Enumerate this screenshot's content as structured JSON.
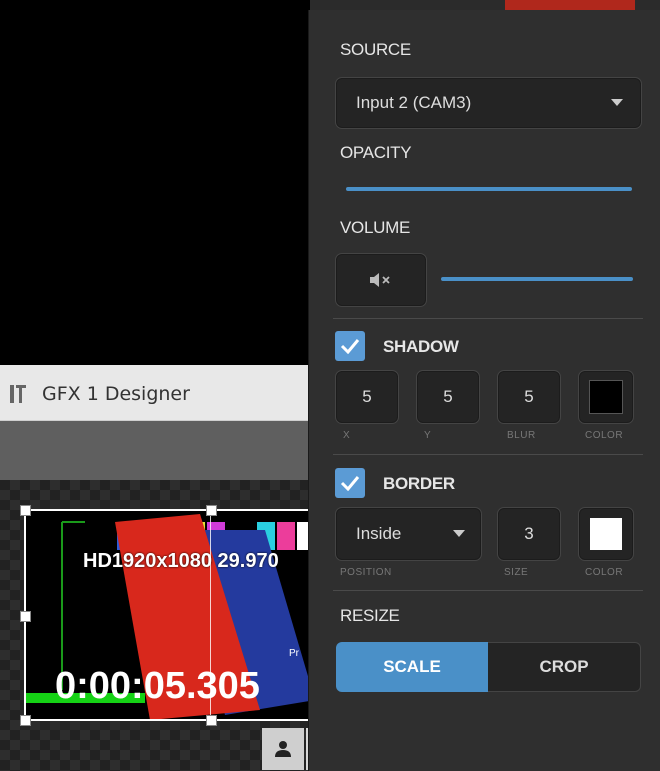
{
  "gfx": {
    "title": "GFX 1 Designer"
  },
  "preview": {
    "format_text": "HD1920x1080 29.970",
    "timecode": "0:00:05.305",
    "corner_text": "Pr"
  },
  "panel": {
    "source": {
      "label": "SOURCE",
      "value": "Input 2 (CAM3)"
    },
    "opacity": {
      "label": "OPACITY",
      "level": 1.0
    },
    "volume": {
      "label": "VOLUME",
      "level": 1.0,
      "mute_icon": "speaker-mute-icon"
    },
    "shadow": {
      "label": "SHADOW",
      "checked": true,
      "x": "5",
      "y": "5",
      "blur": "5",
      "x_label": "X",
      "y_label": "Y",
      "blur_label": "BLUR",
      "color_label": "COLOR",
      "color": "#000000"
    },
    "border": {
      "label": "BORDER",
      "checked": true,
      "position": "Inside",
      "size": "3",
      "position_label": "POSITION",
      "size_label": "SIZE",
      "color_label": "COLOR",
      "color": "#ffffff"
    },
    "resize": {
      "label": "RESIZE",
      "scale_label": "SCALE",
      "crop_label": "CROP",
      "active": "SCALE"
    }
  },
  "toolbar": {
    "person_icon": "person-icon",
    "gear_icon": "gear-icon",
    "close_icon": "close-icon"
  },
  "colors": {
    "accent": "#4a90c8",
    "check": "#5b9bd5"
  }
}
